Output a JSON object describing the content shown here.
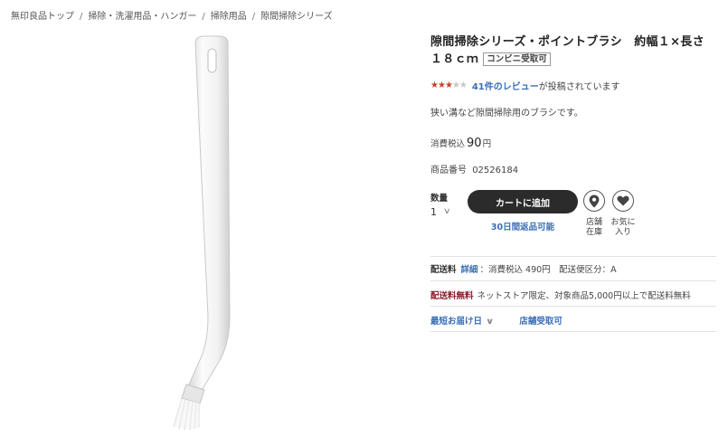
{
  "breadcrumb": {
    "items": [
      "無印良品トップ",
      "掃除・洗濯用品・ハンガー",
      "掃除用品",
      "隙間掃除シリーズ"
    ],
    "separator": "/"
  },
  "product": {
    "title": "隙間掃除シリーズ・ポイントブラシ　約幅１×長さ１８ｃｍ",
    "badge": "コンビニ受取可",
    "rating": 3,
    "rating_max": 5,
    "review_link": "41件のレビュー",
    "review_suffix": "が投稿されています",
    "description": "狭い溝など隙間掃除用のブラシです。",
    "price_label": "消費税込",
    "price_value": "90",
    "price_unit": "円",
    "sku_label": "商品番号",
    "sku_value": "02526184"
  },
  "cart": {
    "qty_label": "数量",
    "qty_value": "1",
    "add_to_cart": "カートに追加",
    "return_note": "30日間返品可能",
    "store_stock_line1": "店舗",
    "store_stock_line2": "在庫",
    "favorite_line1": "お気に",
    "favorite_line2": "入り"
  },
  "shipping": {
    "label": "配送料",
    "detail_link": "詳細",
    "detail_text": "：消費税込 490円　配送便区分：A",
    "free_label": "配送料無料",
    "free_text": "ネットストア限定、対象商品5,000円以上で配送料無料",
    "fastest_link": "最短お届け日",
    "store_pickup_link": "店舗受取可"
  },
  "colors": {
    "accent_link": "#3a6fb8",
    "button_dark": "#2b2b2b",
    "star_on": "#c0442a",
    "free_shipping": "#8a1a2a"
  },
  "icons": {
    "store": "map-pin-icon",
    "favorite": "heart-icon",
    "dropdown": "chevron-down-icon"
  }
}
